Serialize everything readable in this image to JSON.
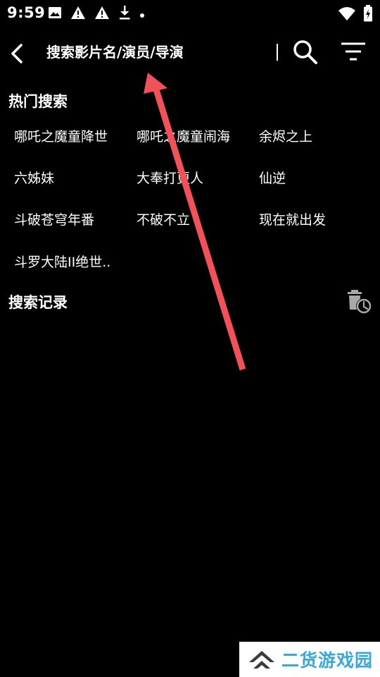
{
  "status_bar": {
    "time": "9:59",
    "icons": [
      "image-icon",
      "warning-icon",
      "warning-icon",
      "download-icon",
      "dot-icon",
      "wifi-icon",
      "battery-icon"
    ]
  },
  "search": {
    "placeholder": "搜索影片名/演员/导演",
    "value": ""
  },
  "hot_search": {
    "title": "热门搜索",
    "items": [
      "哪吒之魔童降世",
      "哪吒之魔童闹海",
      "余烬之上",
      "六姊妹",
      "大奉打更人",
      "仙逆",
      "斗破苍穹年番",
      "不破不立",
      "现在就出发",
      "斗罗大陆II绝世.."
    ]
  },
  "history": {
    "title": "搜索记录"
  },
  "colors": {
    "background": "#000000",
    "text": "#ffffff",
    "arrow": "#f25158",
    "delete_icon": "#a8a8a8",
    "watermark_text": "#39a9dc"
  },
  "watermark": {
    "text": "二货游戏园"
  }
}
